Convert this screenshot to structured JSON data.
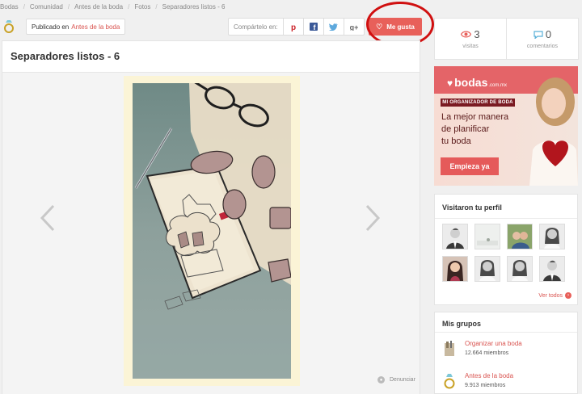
{
  "breadcrumb": [
    "Bodas",
    "Comunidad",
    "Antes de la boda",
    "Fotos",
    "Separadores listos - 6"
  ],
  "published": {
    "label": "Publicado en",
    "link": "Antes de la boda"
  },
  "share": {
    "label": "Compártelo en:",
    "icons": [
      "pinterest-icon",
      "facebook-icon",
      "twitter-icon",
      "google-plus-icon"
    ]
  },
  "like": {
    "label": "Me gusta",
    "icon": "heart-icon"
  },
  "photo": {
    "title": "Separadores listos - 6"
  },
  "report": {
    "label": "Denunciar"
  },
  "stats": {
    "views": {
      "count": "3",
      "label": "visitas"
    },
    "comments": {
      "count": "0",
      "label": "comentarios"
    }
  },
  "ad": {
    "brand": "bodas",
    "brand_suffix": ".com.mx",
    "tagline": "MI ORGANIZADOR DE BODA",
    "headline_lines": [
      "La mejor manera",
      "de planificar",
      "tu boda"
    ],
    "cta": "Empieza ya"
  },
  "visitors": {
    "title": "Visitaron tu perfil",
    "see_all": "Ver todos"
  },
  "groups": {
    "title": "Mis grupos",
    "items": [
      {
        "name": "Organizar una boda",
        "members": "12.664 miembros"
      },
      {
        "name": "Antes de la boda",
        "members": "9.913 miembros"
      }
    ]
  },
  "colors": {
    "accent": "#e8605a",
    "link": "#d9534f",
    "annotation_circle": "#d01010",
    "photo_frame": "#fbf4d6"
  }
}
